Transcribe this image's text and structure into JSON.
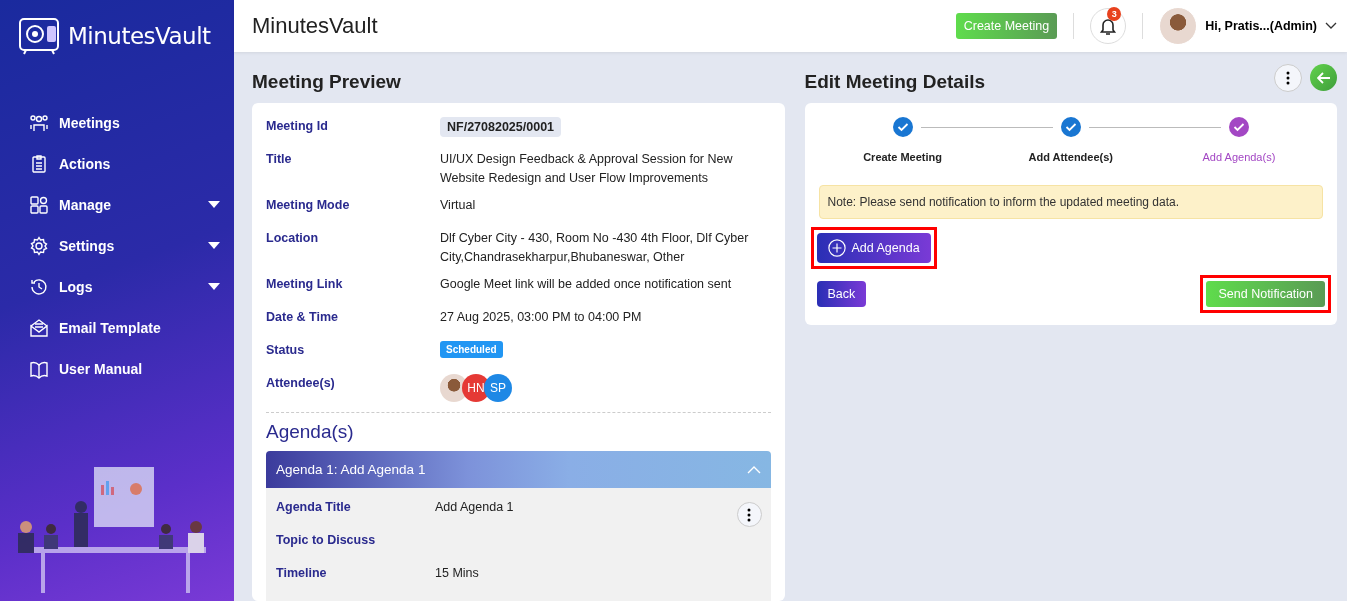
{
  "sidebar": {
    "brand": "MinutesVault",
    "items": [
      {
        "label": "Meetings",
        "has_submenu": false
      },
      {
        "label": "Actions",
        "has_submenu": false
      },
      {
        "label": "Manage",
        "has_submenu": true
      },
      {
        "label": "Settings",
        "has_submenu": true
      },
      {
        "label": "Logs",
        "has_submenu": true
      },
      {
        "label": "Email Template",
        "has_submenu": false
      },
      {
        "label": "User Manual",
        "has_submenu": false
      }
    ]
  },
  "topbar": {
    "title": "MinutesVault",
    "create_button": "Create Meeting",
    "notification_count": "3",
    "user": "Hi, Pratis...(Admin)"
  },
  "preview": {
    "heading": "Meeting Preview",
    "fields": [
      {
        "kind": "chip",
        "label": "Meeting Id",
        "value": "NF/27082025/0001"
      },
      {
        "kind": "text",
        "label": "Title",
        "value": "UI/UX Design Feedback & Approval Session for New Website Redesign and User Flow Improvements"
      },
      {
        "kind": "text",
        "label": "Meeting Mode",
        "value": "Virtual"
      },
      {
        "kind": "text",
        "label": "Location",
        "value": "Dlf Cyber City - 430, Room No -430 4th Floor, Dlf Cyber City,Chandrasekharpur,Bhubaneswar, Other"
      },
      {
        "kind": "text",
        "label": "Meeting Link",
        "value": "Google Meet link will be added once notification sent"
      },
      {
        "kind": "text",
        "label": "Date & Time",
        "value": "27 Aug 2025, 03:00 PM to 04:00 PM"
      },
      {
        "kind": "status",
        "label": "Status",
        "value": "Scheduled"
      },
      {
        "kind": "attendees",
        "label": "Attendee(s)"
      }
    ],
    "attendees": [
      {
        "kind": "photo"
      },
      {
        "kind": "initials",
        "initials": "HN",
        "color": "#e53935"
      },
      {
        "kind": "initials",
        "initials": "SP",
        "color": "#1e88e5"
      }
    ],
    "agenda_heading": "Agenda(s)",
    "agendas": [
      {
        "header": "Agenda 1: Add Agenda 1",
        "expanded": true,
        "fields": [
          {
            "label": "Agenda Title",
            "value": "Add Agenda 1"
          },
          {
            "label": "Topic to Discuss"
          },
          {
            "label": "Timeline",
            "value": "15 Mins"
          }
        ]
      }
    ]
  },
  "edit": {
    "heading": "Edit Meeting Details",
    "steps": [
      {
        "label": "Create Meeting",
        "selected": false
      },
      {
        "label": "Add Attendee(s)",
        "selected": false
      },
      {
        "label": "Add Agenda(s)",
        "selected": true
      }
    ],
    "note": "Note: Please send notification to inform the updated meeting data.",
    "add_button": {
      "label": "Add Agenda",
      "highlighted": true
    },
    "back_button": {
      "label": "Back",
      "highlighted": false
    },
    "send_button": {
      "label": "Send Notification",
      "highlighted": true
    }
  }
}
